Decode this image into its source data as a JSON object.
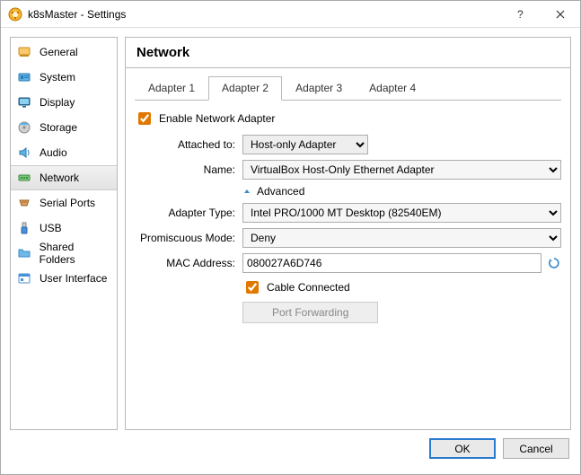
{
  "window": {
    "title": "k8sMaster - Settings"
  },
  "sidebar": {
    "items": [
      {
        "label": "General"
      },
      {
        "label": "System"
      },
      {
        "label": "Display"
      },
      {
        "label": "Storage"
      },
      {
        "label": "Audio"
      },
      {
        "label": "Network"
      },
      {
        "label": "Serial Ports"
      },
      {
        "label": "USB"
      },
      {
        "label": "Shared Folders"
      },
      {
        "label": "User Interface"
      }
    ]
  },
  "main": {
    "heading": "Network",
    "tabs": [
      {
        "label": "Adapter 1"
      },
      {
        "label": "Adapter 2"
      },
      {
        "label": "Adapter 3"
      },
      {
        "label": "Adapter 4"
      }
    ],
    "enable_label": "Enable Network Adapter",
    "labels": {
      "attached": "Attached to:",
      "name": "Name:",
      "advanced": "Advanced",
      "adapter_type": "Adapter Type:",
      "promiscuous": "Promiscuous Mode:",
      "mac": "MAC Address:",
      "cable": "Cable Connected",
      "portfwd": "Port Forwarding"
    },
    "values": {
      "attached": "Host-only Adapter",
      "name": "VirtualBox Host-Only Ethernet Adapter",
      "adapter_type": "Intel PRO/1000 MT Desktop (82540EM)",
      "promiscuous": "Deny",
      "mac": "080027A6D746",
      "enable_checked": true,
      "cable_checked": true
    }
  },
  "footer": {
    "ok": "OK",
    "cancel": "Cancel"
  }
}
